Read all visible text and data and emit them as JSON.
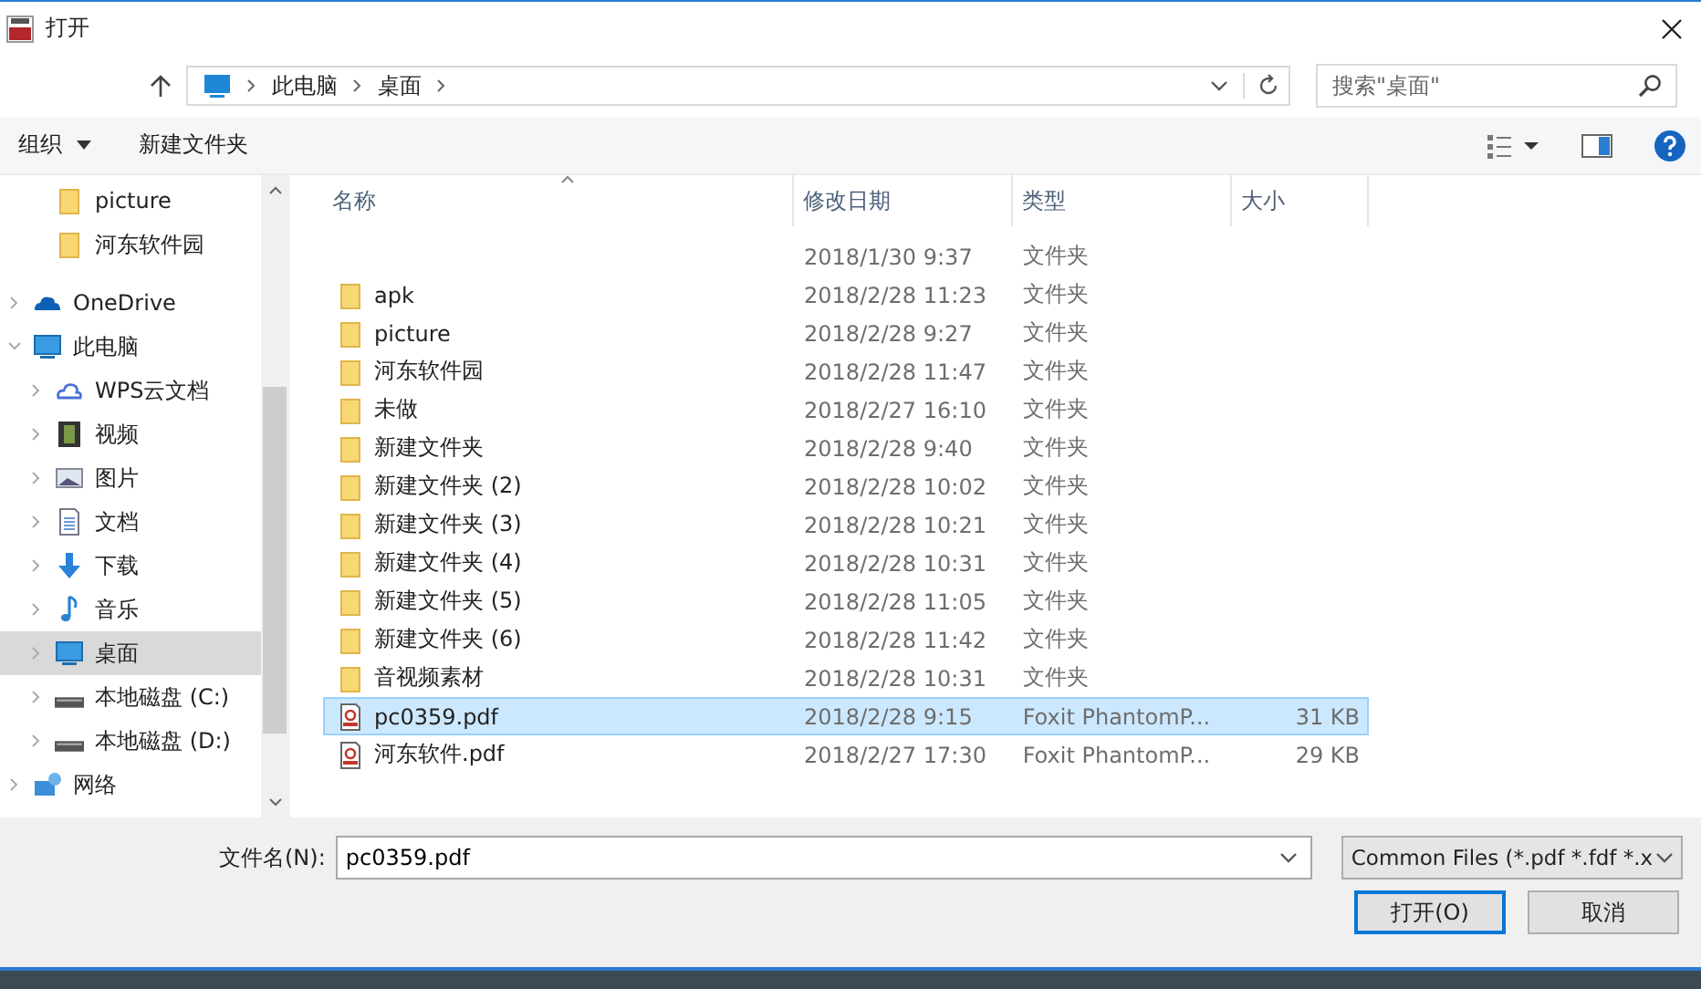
{
  "window": {
    "title": "打开"
  },
  "address": {
    "path": [
      "此电脑",
      "桌面"
    ],
    "search_placeholder": "搜索\"桌面\""
  },
  "toolbar": {
    "organize": "组织",
    "new_folder": "新建文件夹"
  },
  "sidebar": {
    "items": [
      {
        "children": [
          {
            "label": "picture",
            "kind": "folder",
            "selected": false
          },
          {
            "label": "河东软件园",
            "kind": "folder",
            "selected": false
          }
        ]
      },
      {
        "label": "OneDrive",
        "kind": "onedrive",
        "expanded": false,
        "selected": false
      },
      {
        "label": "此电脑",
        "kind": "pc",
        "expanded": true,
        "selected": false,
        "children": [
          {
            "label": "WPS云文档",
            "kind": "cloud",
            "expanded": false,
            "selected": false
          },
          {
            "label": "视频",
            "kind": "video",
            "expanded": false,
            "selected": false
          },
          {
            "label": "图片",
            "kind": "image",
            "expanded": false,
            "selected": false
          },
          {
            "label": "文档",
            "kind": "doc",
            "expanded": false,
            "selected": false
          },
          {
            "label": "下载",
            "kind": "download",
            "expanded": false,
            "selected": false
          },
          {
            "label": "音乐",
            "kind": "music",
            "expanded": false,
            "selected": false
          },
          {
            "label": "桌面",
            "kind": "desktop",
            "expanded": false,
            "selected": true
          },
          {
            "label": "本地磁盘 (C:)",
            "kind": "drive",
            "expanded": false,
            "selected": false
          },
          {
            "label": "本地磁盘 (D:)",
            "kind": "drive",
            "expanded": false,
            "selected": false
          }
        ]
      },
      {
        "label": "网络",
        "kind": "network",
        "expanded": false,
        "selected": false
      }
    ]
  },
  "table": {
    "columns": [
      "名称",
      "修改日期",
      "类型",
      "大小"
    ],
    "rows": [
      {
        "date": "2018/1/30 9:37",
        "type": "文件夹",
        "selected": false
      },
      {
        "kind": "folder",
        "name": "apk",
        "date": "2018/2/28 11:23",
        "type": "文件夹",
        "selected": false
      },
      {
        "kind": "folder",
        "name": "picture",
        "date": "2018/2/28 9:27",
        "type": "文件夹",
        "selected": false
      },
      {
        "kind": "folder",
        "name": "河东软件园",
        "date": "2018/2/28 11:47",
        "type": "文件夹",
        "selected": false
      },
      {
        "kind": "folder",
        "name": "未做",
        "date": "2018/2/27 16:10",
        "type": "文件夹",
        "selected": false
      },
      {
        "kind": "folder",
        "name": "新建文件夹",
        "date": "2018/2/28 9:40",
        "type": "文件夹",
        "selected": false
      },
      {
        "kind": "folder",
        "name": "新建文件夹 (2)",
        "date": "2018/2/28 10:02",
        "type": "文件夹",
        "selected": false
      },
      {
        "kind": "folder",
        "name": "新建文件夹 (3)",
        "date": "2018/2/28 10:21",
        "type": "文件夹",
        "selected": false
      },
      {
        "kind": "folder",
        "name": "新建文件夹 (4)",
        "date": "2018/2/28 10:31",
        "type": "文件夹",
        "selected": false
      },
      {
        "kind": "folder",
        "name": "新建文件夹 (5)",
        "date": "2018/2/28 11:05",
        "type": "文件夹",
        "selected": false
      },
      {
        "kind": "folder",
        "name": "新建文件夹 (6)",
        "date": "2018/2/28 11:42",
        "type": "文件夹",
        "selected": false
      },
      {
        "kind": "folder",
        "name": "音视频素材",
        "date": "2018/2/28 10:31",
        "type": "文件夹",
        "selected": false
      },
      {
        "kind": "pdf",
        "name": "pc0359.pdf",
        "date": "2018/2/28 9:15",
        "type": "Foxit PhantomP...",
        "size": "31 KB",
        "selected": true
      },
      {
        "kind": "pdf",
        "name": "河东软件.pdf",
        "date": "2018/2/27 17:30",
        "type": "Foxit PhantomP...",
        "size": "29 KB",
        "selected": false
      }
    ]
  },
  "footer": {
    "filename_label": "文件名(N):",
    "filename": "pc0359.pdf",
    "filter": "Common Files (*.pdf *.fdf *.x",
    "open": "打开(O)",
    "cancel": "取消"
  }
}
